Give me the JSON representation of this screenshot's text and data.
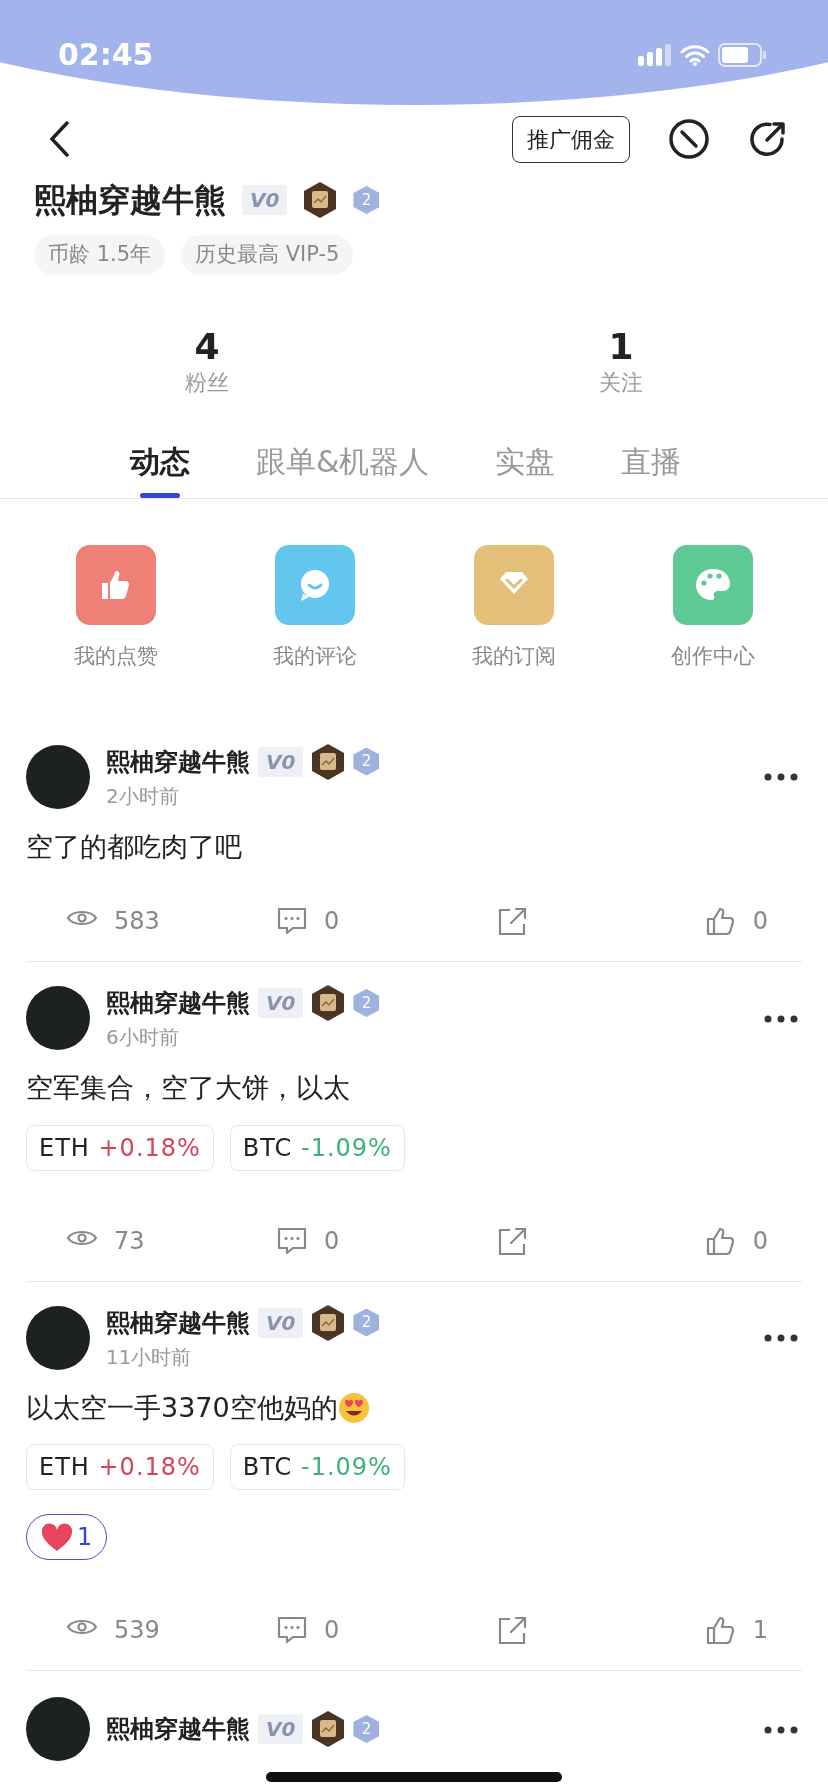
{
  "status_bar": {
    "time": "02:45"
  },
  "header": {
    "promo_button": "推广佣金"
  },
  "profile": {
    "name": "熙柚穿越牛熊",
    "level": "V0",
    "rank": "2",
    "tags": [
      "币龄 1.5年",
      "历史最高 VIP-5"
    ]
  },
  "stats": [
    {
      "value": "4",
      "label": "粉丝"
    },
    {
      "value": "1",
      "label": "关注"
    }
  ],
  "tabs": [
    {
      "label": "动态",
      "selected": true
    },
    {
      "label": "跟单&机器人",
      "selected": false
    },
    {
      "label": "实盘",
      "selected": false
    },
    {
      "label": "直播",
      "selected": false
    }
  ],
  "shortcuts": [
    {
      "label": "我的点赞",
      "kind": "like",
      "color": "#ee8077"
    },
    {
      "label": "我的评论",
      "kind": "comment",
      "color": "#62c6ee"
    },
    {
      "label": "我的订阅",
      "kind": "subscribe",
      "color": "#e3bf7a"
    },
    {
      "label": "创作中心",
      "kind": "create",
      "color": "#5ec994"
    }
  ],
  "posts": [
    {
      "author": "熙柚穿越牛熊",
      "level": "V0",
      "rank": "2",
      "time": "2小时前",
      "text": "空了的都吃肉了吧",
      "views": "583",
      "comments": "0",
      "likes": "0"
    },
    {
      "author": "熙柚穿越牛熊",
      "level": "V0",
      "rank": "2",
      "time": "6小时前",
      "text": "空军集合，空了大饼，以太",
      "tickers": [
        {
          "symbol": "ETH",
          "change": "+0.18%",
          "color": "#d5445a"
        },
        {
          "symbol": "BTC",
          "change": "-1.09%",
          "color": "#3eb07c"
        }
      ],
      "views": "73",
      "comments": "0",
      "likes": "0"
    },
    {
      "author": "熙柚穿越牛熊",
      "level": "V0",
      "rank": "2",
      "time": "11小时前",
      "text": "以太空一手3370空他妈的",
      "emoji": true,
      "tickers": [
        {
          "symbol": "ETH",
          "change": "+0.18%",
          "color": "#d5445a"
        },
        {
          "symbol": "BTC",
          "change": "-1.09%",
          "color": "#3eb07c"
        }
      ],
      "reactions": [
        {
          "kind": "heart",
          "count": "1"
        }
      ],
      "views": "539",
      "comments": "0",
      "likes": "1"
    }
  ],
  "partial_post": {
    "author": "熙柚穿越牛熊",
    "level": "V0",
    "rank": "2"
  }
}
